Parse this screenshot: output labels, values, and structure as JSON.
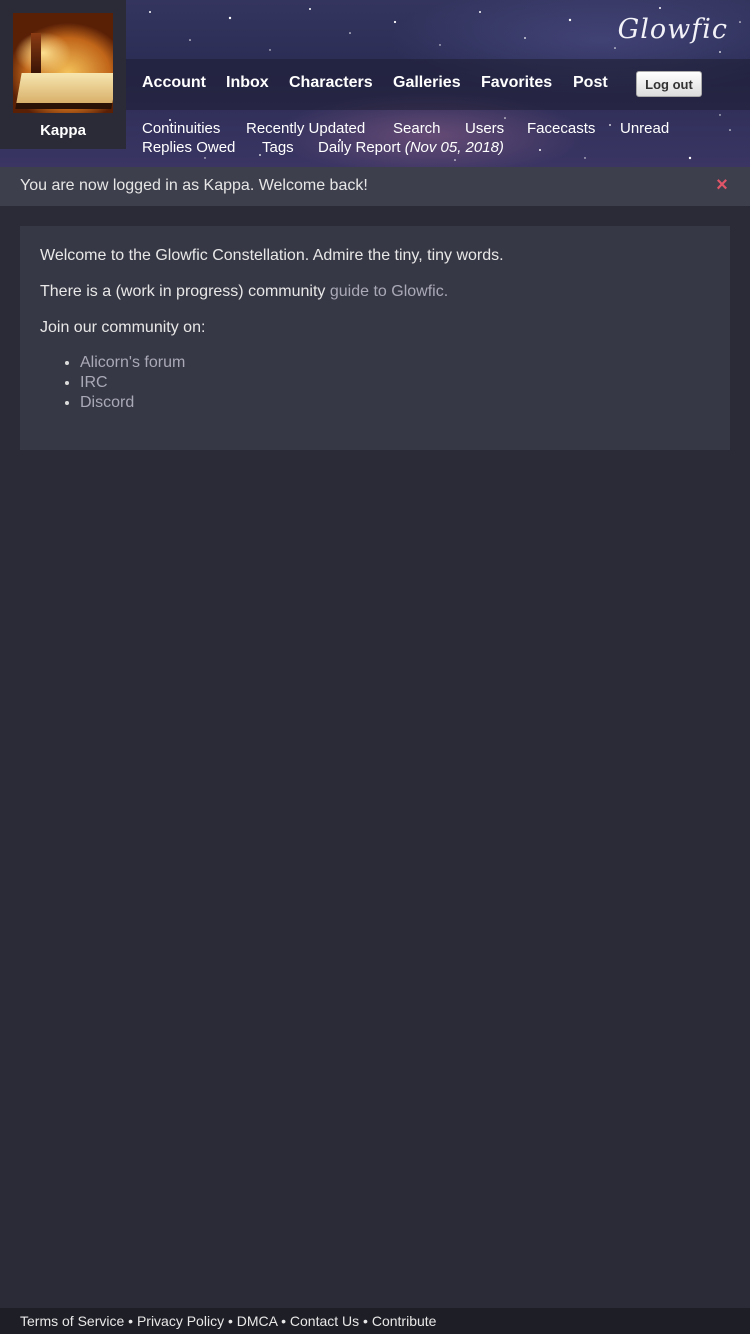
{
  "header": {
    "logo": "Glowfic",
    "username": "Kappa",
    "main_nav": [
      "Account",
      "Inbox",
      "Characters",
      "Galleries",
      "Favorites",
      "Post"
    ],
    "logout_label": "Log out",
    "sub_nav_row1": [
      "Continuities",
      "Recently Updated",
      "Search",
      "Users",
      "Facecasts",
      "Unread"
    ],
    "sub_nav_row2": [
      "Replies Owed",
      "Tags",
      "Daily Report"
    ],
    "daily_report_date": "(Nov 05, 2018)"
  },
  "flash": {
    "message": "You are now logged in as Kappa. Welcome back!",
    "close_icon": "×"
  },
  "content": {
    "welcome": "Welcome to the Glowfic Constellation. Admire the tiny, tiny words.",
    "guide_prefix": "There is a (work in progress) community ",
    "guide_link": "guide to Glowfic.",
    "join_text": "Join our community on:",
    "community_links": [
      "Alicorn's forum",
      "IRC",
      "Discord"
    ]
  },
  "footer": {
    "links": [
      "Terms of Service",
      "Privacy Policy",
      "DMCA",
      "Contact Us",
      "Contribute"
    ],
    "separator": "•"
  },
  "colors": {
    "background": "#2b2b37",
    "panel": "#373845",
    "link": "#a9a9b8",
    "close": "#e05567"
  }
}
